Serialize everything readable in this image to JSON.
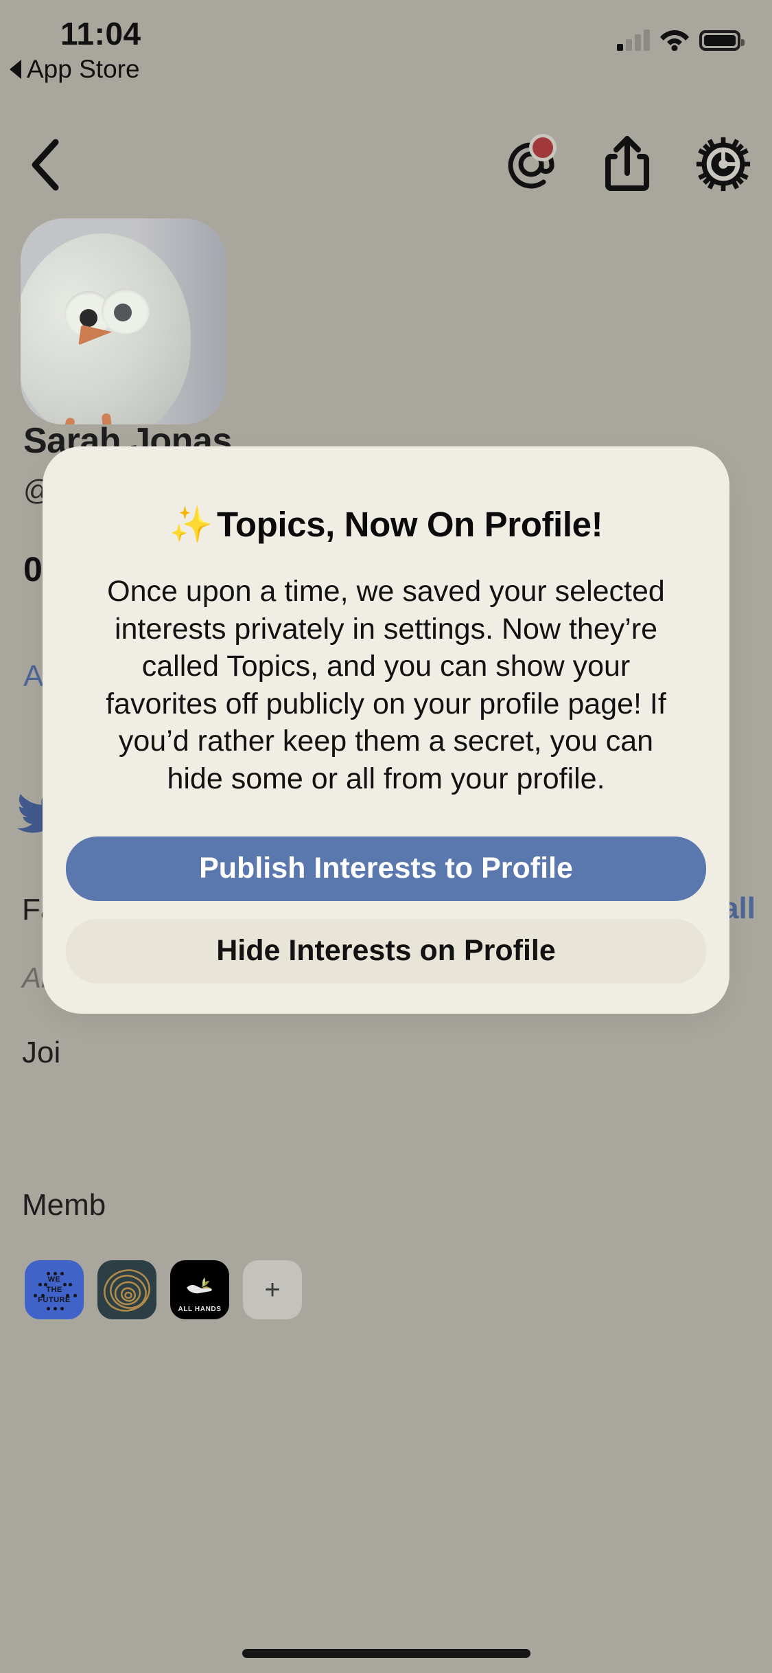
{
  "status_bar": {
    "time": "11:04",
    "back_app_label": "App Store",
    "signal_icon": "cellular-signal-icon",
    "wifi_icon": "wifi-icon",
    "battery_icon": "battery-icon"
  },
  "nav_bar": {
    "back_icon": "chevron-left-icon",
    "mentions_icon": "at-mention-icon",
    "mentions_badge": "",
    "share_icon": "share-icon",
    "settings_icon": "gear-icon"
  },
  "profile": {
    "avatar_icon": "user-avatar-image",
    "display_name": "Sarah Jonas",
    "handle_truncated": "@s",
    "stat_count": "0",
    "add_link_truncated": "Ad",
    "twitter_icon": "twitter-bird-icon",
    "fa_truncated": "Fa",
    "all_truncated": "All",
    "join_truncated": "Joi",
    "members_truncated": "Memb",
    "see_all_truncated": "all"
  },
  "communities": [
    {
      "name": "we-the-future",
      "line1": "WE",
      "line2": "THE",
      "line3": "FUTURE",
      "color": "#3f63c8"
    },
    {
      "name": "spiral-community",
      "label": "",
      "color": "#2c3f45"
    },
    {
      "name": "all-hands",
      "label": "ALL HANDS",
      "color": "#000000"
    }
  ],
  "add_community": {
    "label": "+",
    "icon": "plus-icon"
  },
  "modal": {
    "sparkle_icon": "✨",
    "title": "Topics, Now On Profile!",
    "body": "Once upon a time, we saved your selected interests privately in settings. Now they’re called Topics, and you can show your favorites off publicly on your profile page! If you’d rather keep them a secret, you can hide some or all from your profile.",
    "primary_button": "Publish Interests to Profile",
    "secondary_button": "Hide Interests on Profile",
    "primary_color": "#5b78ae",
    "card_color": "#f0ede4"
  }
}
